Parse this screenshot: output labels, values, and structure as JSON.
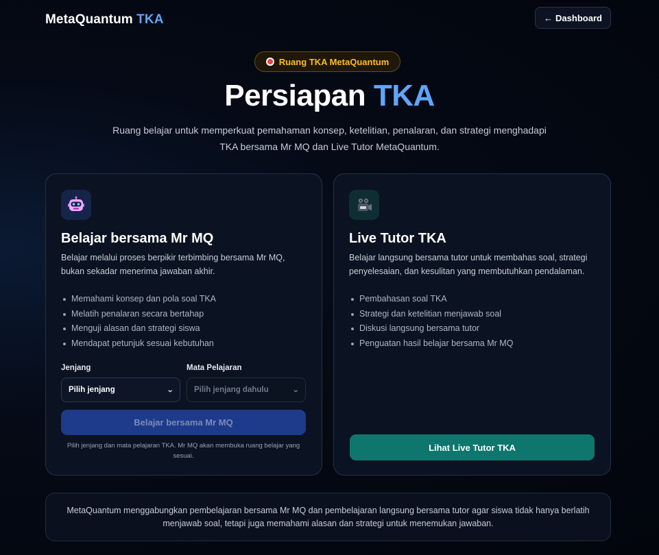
{
  "header": {
    "brand_main": "MetaQuantum",
    "brand_accent": "TKA",
    "dashboard_arrow": "←",
    "dashboard_label": "Dashboard"
  },
  "hero": {
    "badge_icon": "target-icon",
    "badge_label": "Ruang TKA MetaQuantum",
    "title_main": "Persiapan",
    "title_accent": "TKA",
    "subtitle": "Ruang belajar untuk memperkuat pemahaman konsep, ketelitian, penalaran, dan strategi menghadapi TKA bersama Mr MQ dan Live Tutor MetaQuantum."
  },
  "cards": {
    "mrmq": {
      "icon": "robot-icon",
      "title": "Belajar bersama Mr MQ",
      "description": "Belajar melalui proses berpikir terbimbing bersama Mr MQ, bukan sekadar menerima jawaban akhir.",
      "items": [
        "Memahami konsep dan pola soal TKA",
        "Melatih penalaran secara bertahap",
        "Menguji alasan dan strategi siswa",
        "Mendapat petunjuk sesuai kebutuhan"
      ],
      "jenjang_label": "Jenjang",
      "jenjang_value": "Pilih jenjang",
      "mapel_label": "Mata Pelajaran",
      "mapel_value": "Pilih jenjang dahulu",
      "button_label": "Belajar bersama Mr MQ",
      "hint": "Pilih jenjang dan mata pelajaran TKA. Mr MQ akan membuka ruang belajar yang sesuai."
    },
    "tutor": {
      "icon": "video-camera-icon",
      "title": "Live Tutor TKA",
      "description": "Belajar langsung bersama tutor untuk membahas soal, strategi penyelesaian, dan kesulitan yang membutuhkan pendalaman.",
      "items": [
        "Pembahasan soal TKA",
        "Strategi dan ketelitian menjawab soal",
        "Diskusi langsung bersama tutor",
        "Penguatan hasil belajar bersama Mr MQ"
      ],
      "button_label": "Lihat Live Tutor TKA"
    }
  },
  "footer_note": "MetaQuantum menggabungkan pembelajaran bersama Mr MQ dan pembelajaran langsung bersama tutor agar siswa tidak hanya berlatih menjawab soal, tetapi juga memahami alasan dan strategi untuk menemukan jawaban.",
  "colors": {
    "accent_blue": "#60a5fa",
    "badge_gold": "#fbbf24",
    "primary_button": "#1e3a8a",
    "teal_button": "#0f766e"
  }
}
